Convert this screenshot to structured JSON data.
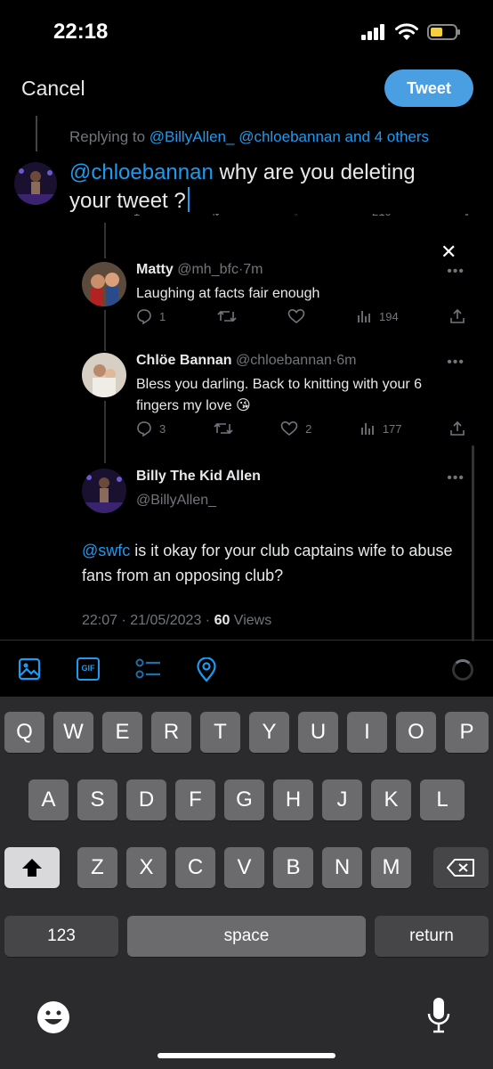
{
  "status_bar": {
    "time": "22:18"
  },
  "header": {
    "cancel_label": "Cancel",
    "tweet_label": "Tweet"
  },
  "composer": {
    "replying_prefix": "Replying to ",
    "replying_users": "@BillyAllen_ @chloebannan and 4 others",
    "mention": "@chloebannan",
    "text": " why are you deleting your tweet ?"
  },
  "ghost_row": {
    "reply": "1",
    "views": "210"
  },
  "tweets": [
    {
      "name": "Matty",
      "handle": "@mh_bfc",
      "time": "7m",
      "text": "Laughing at facts fair enough",
      "replies": "1",
      "retweets": "",
      "likes": "",
      "views": "194"
    },
    {
      "name": "Chlöe Bannan",
      "handle": "@chloebannan",
      "time": "6m",
      "text": "Bless you darling. Back to knitting with your 6 fingers my love 😘",
      "replies": "3",
      "retweets": "",
      "likes": "2",
      "views": "177"
    }
  ],
  "main_tweet": {
    "name": "Billy The Kid Allen",
    "handle": "@BillyAllen_",
    "mention": "@swfc",
    "text": " is it okay for your club captains wife to abuse fans from an opposing club?",
    "timestamp": "22:07 · 21/05/2023 · ",
    "views_count": "60",
    "views_label": " Views"
  },
  "toolbar": {
    "icons": [
      "image-icon",
      "gif-icon",
      "poll-icon",
      "location-icon"
    ],
    "gif_label": "GIF"
  },
  "keyboard": {
    "row1": [
      "Q",
      "W",
      "E",
      "R",
      "T",
      "Y",
      "U",
      "I",
      "O",
      "P"
    ],
    "row2": [
      "A",
      "S",
      "D",
      "F",
      "G",
      "H",
      "J",
      "K",
      "L"
    ],
    "row3": [
      "Z",
      "X",
      "C",
      "V",
      "B",
      "N",
      "M"
    ],
    "numbers_label": "123",
    "space_label": "space",
    "return_label": "return"
  },
  "colors": {
    "accent": "#1d9bf0",
    "tweet_button": "#4a9fe3",
    "muted": "#71767b"
  }
}
